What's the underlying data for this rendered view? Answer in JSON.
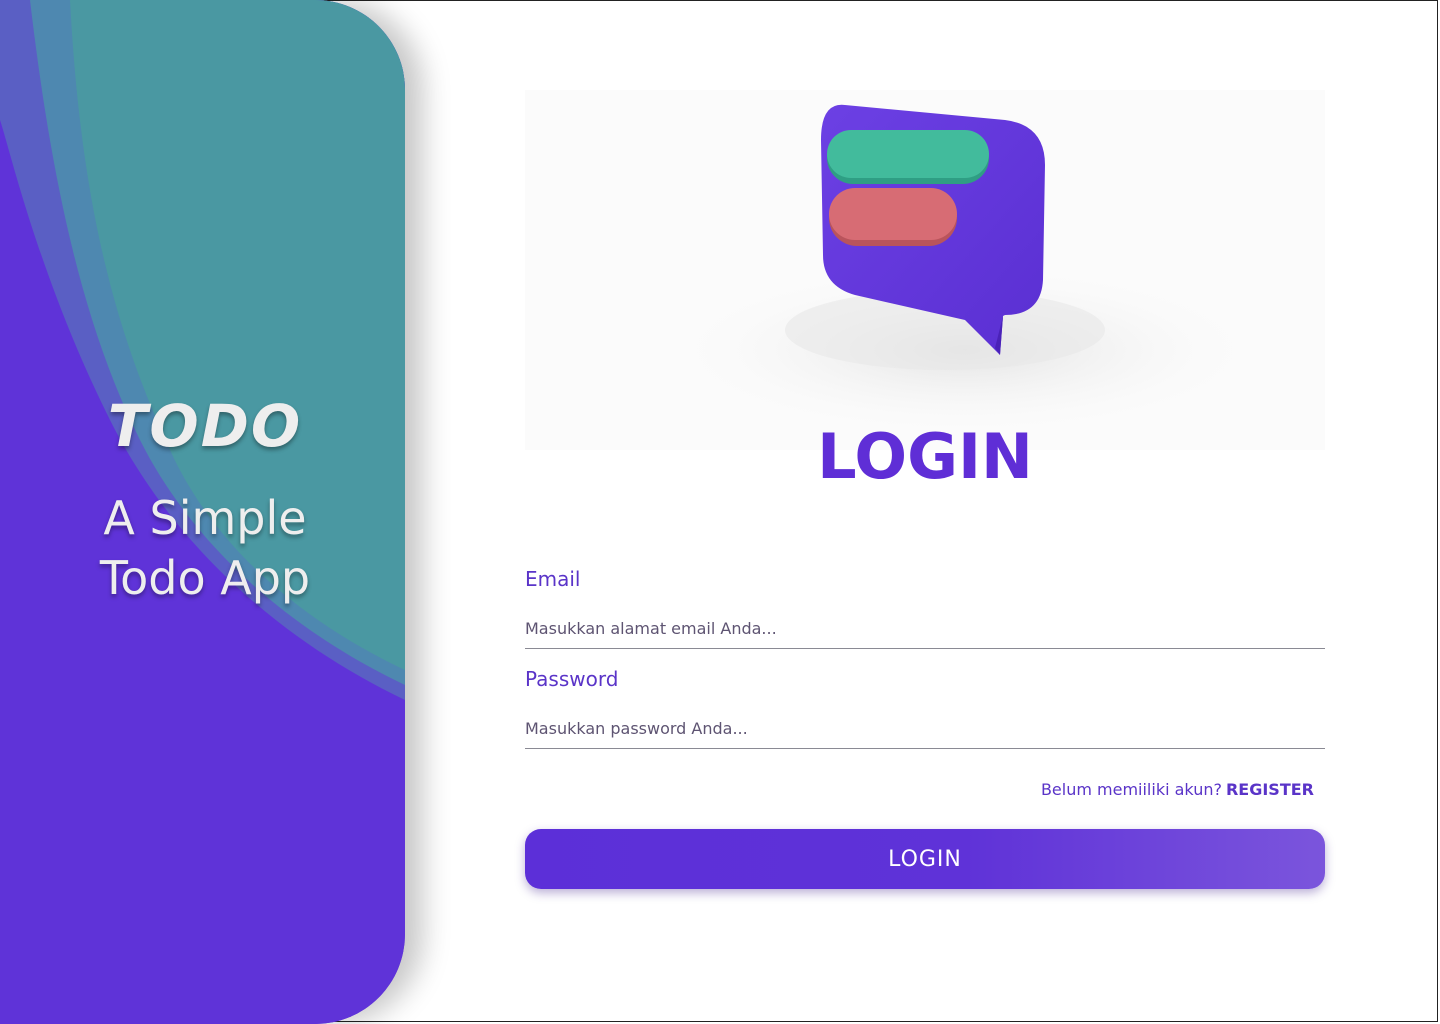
{
  "hero": {
    "logo_text": "TODO",
    "tagline_line1": "A Simple",
    "tagline_line2": "Todo App"
  },
  "login": {
    "title": "LOGIN",
    "email_label": "Email",
    "email_placeholder": "Masukkan alamat email Anda...",
    "email_value": "",
    "password_label": "Password",
    "password_placeholder": "Masukkan password Anda...",
    "password_value": "",
    "register_prompt": "Belum memiiliki akun?",
    "register_link": "REGISTER",
    "button_label": "LOGIN"
  },
  "icons": {
    "illustration": "chat-bubble-icon"
  },
  "colors": {
    "primary": "#5f2ed6",
    "teal": "#4a97a1",
    "bubble_green": "#40b99b",
    "bubble_red": "#d96b73"
  }
}
